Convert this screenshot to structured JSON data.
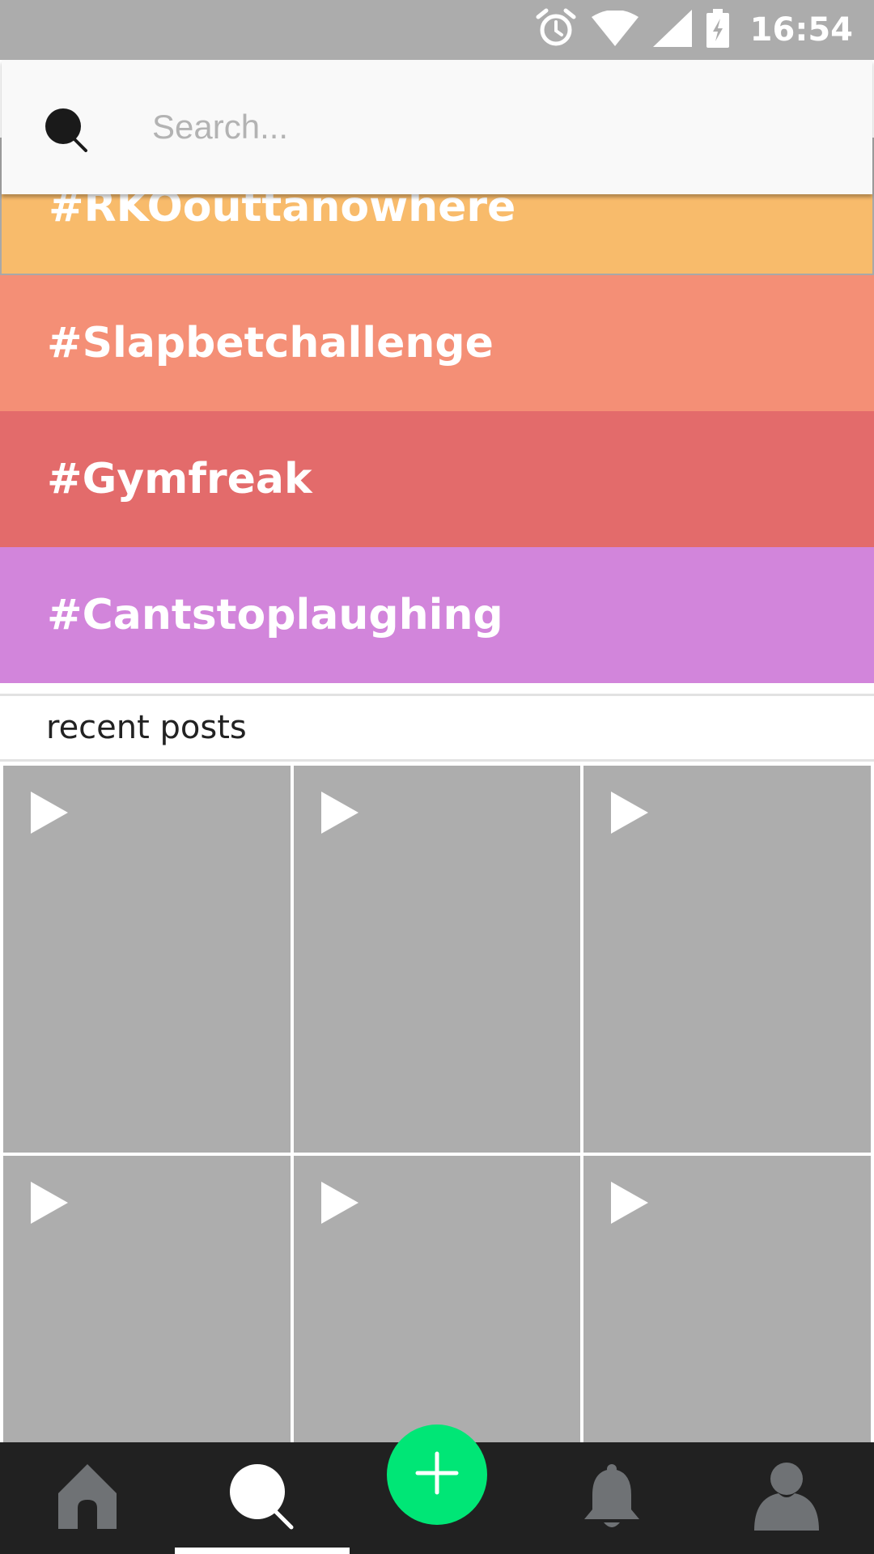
{
  "status_bar": {
    "time": "16:54",
    "icons": [
      "alarm-icon",
      "wifi-icon",
      "signal-icon",
      "battery-charging-icon"
    ]
  },
  "search": {
    "placeholder": "Search...",
    "value": "",
    "icon": "search-icon"
  },
  "hashtags": [
    {
      "label": "#RKOouttanowhere",
      "color": "#f8bb6b"
    },
    {
      "label": "#Slapbetchallenge",
      "color": "#f48f76"
    },
    {
      "label": "#Gymfreak",
      "color": "#e36b6b"
    },
    {
      "label": "#Cantstoplaughing",
      "color": "#d285db"
    }
  ],
  "recent_posts": {
    "title": "recent posts",
    "tiles": [
      {
        "icon": "play-icon"
      },
      {
        "icon": "play-icon"
      },
      {
        "icon": "play-icon"
      },
      {
        "icon": "play-icon"
      },
      {
        "icon": "play-icon"
      },
      {
        "icon": "play-icon"
      }
    ]
  },
  "bottom_nav": {
    "items": [
      {
        "icon": "home-icon",
        "active": false
      },
      {
        "icon": "search-icon",
        "active": true
      },
      {
        "icon": "add-icon",
        "active": false
      },
      {
        "icon": "bell-icon",
        "active": false
      },
      {
        "icon": "profile-icon",
        "active": false
      }
    ],
    "fab_color": "#00e676",
    "active_color": "#ffffff",
    "inactive_color": "#6f7275"
  }
}
